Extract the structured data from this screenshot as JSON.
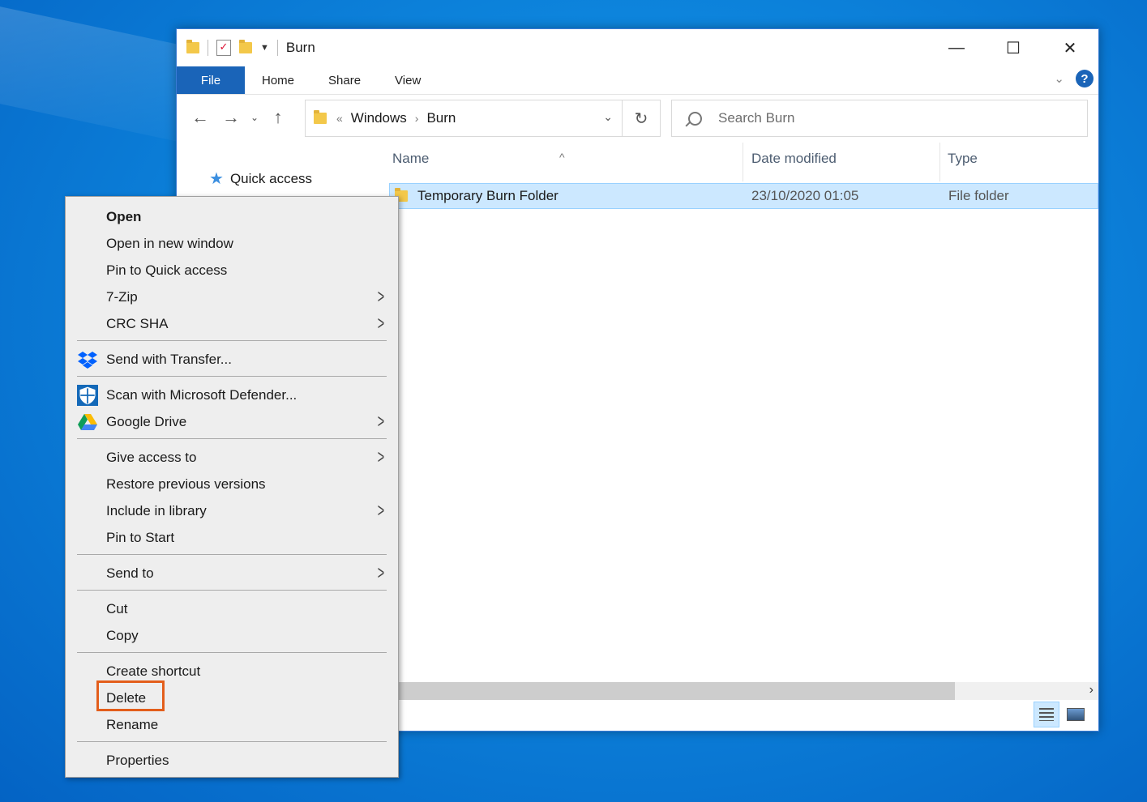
{
  "window": {
    "title": "Burn",
    "controls": {
      "minimize": "—",
      "maximize": "☐",
      "close": "✕"
    }
  },
  "ribbon": {
    "tabs": [
      "File",
      "Home",
      "Share",
      "View"
    ],
    "help": "?"
  },
  "nav": {
    "back": "←",
    "forward": "→",
    "recent": "⌄",
    "up": "↑",
    "address": {
      "prefix": "«",
      "crumbs": [
        "Windows",
        "Burn"
      ],
      "sep": "›"
    },
    "refresh": "↻",
    "search_placeholder": "Search Burn"
  },
  "navpane": {
    "quick_access": "Quick access"
  },
  "columns": {
    "name": "Name",
    "date": "Date modified",
    "type": "Type"
  },
  "files": [
    {
      "name": "Temporary Burn Folder",
      "date": "23/10/2020 01:05",
      "type": "File folder",
      "selected": true
    }
  ],
  "context_menu": {
    "items": [
      {
        "label": "Open",
        "bold": true
      },
      {
        "label": "Open in new window"
      },
      {
        "label": "Pin to Quick access"
      },
      {
        "label": "7-Zip",
        "submenu": true
      },
      {
        "label": "CRC SHA",
        "submenu": true
      },
      {
        "label": "Send with Transfer...",
        "icon": "dropbox-icon"
      },
      {
        "label": "Scan with Microsoft Defender...",
        "icon": "defender-shield-icon"
      },
      {
        "label": "Google Drive",
        "icon": "google-drive-icon",
        "submenu": true
      },
      {
        "label": "Give access to",
        "submenu": true
      },
      {
        "label": "Restore previous versions"
      },
      {
        "label": "Include in library",
        "submenu": true
      },
      {
        "label": "Pin to Start"
      },
      {
        "label": "Send to",
        "submenu": true
      },
      {
        "label": "Cut"
      },
      {
        "label": "Copy"
      },
      {
        "label": "Create shortcut"
      },
      {
        "label": "Delete",
        "highlighted": true
      },
      {
        "label": "Rename"
      },
      {
        "label": "Properties"
      }
    ],
    "highlight_color": "#e35e1b"
  },
  "colors": {
    "accent": "#1a64b8",
    "selection": "#cce8ff"
  }
}
